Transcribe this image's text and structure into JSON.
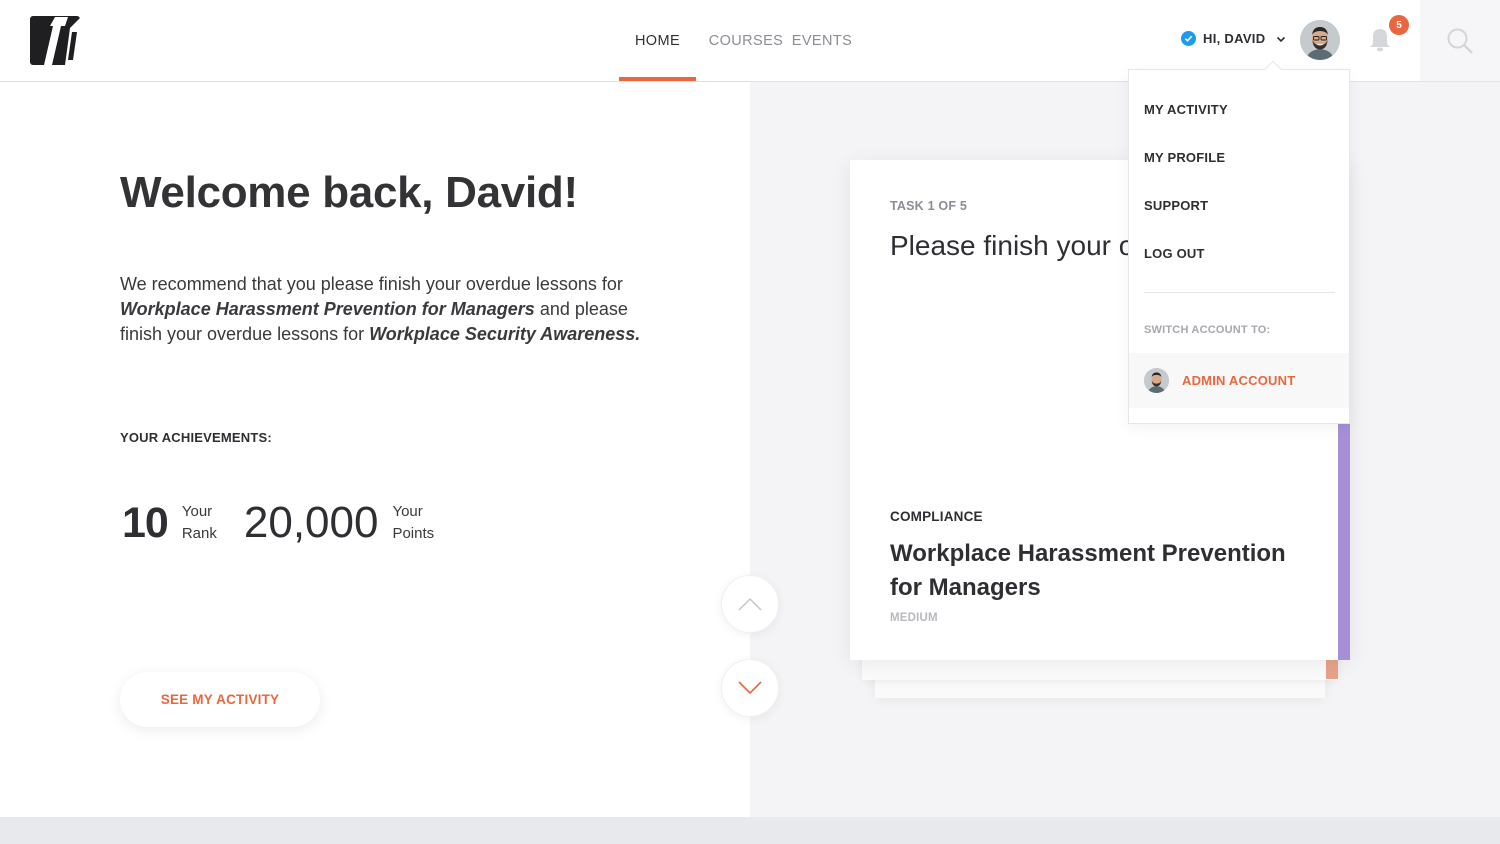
{
  "header": {
    "logo": "brand-logo",
    "nav": [
      {
        "label": "HOME",
        "active": true
      },
      {
        "label": "COURSES",
        "active": false
      },
      {
        "label": "EVENTS",
        "active": false
      }
    ],
    "greeting": "HI, DAVID",
    "notification_count": "5",
    "accent_color": "#e8673f"
  },
  "dropdown": {
    "items": [
      "MY ACTIVITY",
      "MY PROFILE",
      "SUPPORT",
      "LOG OUT"
    ],
    "switch_label": "SWITCH ACCOUNT TO:",
    "admin_account": "ADMIN ACCOUNT"
  },
  "main": {
    "welcome": "Welcome back, David!",
    "recommend": {
      "part1": "We recommend that you please finish your overdue lessons for ",
      "course1": "Workplace Harassment Prevention for Managers",
      "part2": " and please finish your overdue lessons for ",
      "course2": "Workplace Security Awareness",
      "part3": "."
    },
    "achievements_title": "YOUR ACHIEVEMENTS:",
    "rank": {
      "value": "10",
      "label_line1": "Your",
      "label_line2": "Rank"
    },
    "points": {
      "value": "20,000",
      "label_line1": "Your",
      "label_line2": "Points"
    },
    "see_activity_button": "SEE MY ACTIVITY"
  },
  "task_card": {
    "task_label": "TASK 1 OF 5",
    "task_text": "Please finish your overdue course.",
    "category": "COMPLIANCE",
    "course_title": "Workplace Harassment Prevention for Managers",
    "difficulty": "MEDIUM",
    "accent_color": "#a58fd6",
    "next_accent_color": "#e8a28a"
  }
}
